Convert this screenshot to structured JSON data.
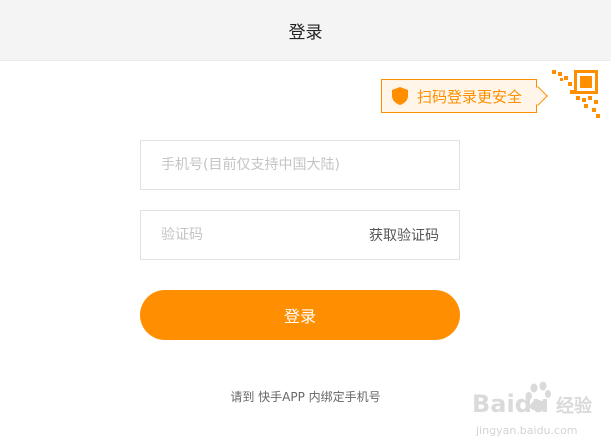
{
  "header": {
    "title": "登录"
  },
  "qr_login": {
    "tip_text": "扫码登录更安全",
    "icon": "shield-icon",
    "corner_icon": "qr-code-icon"
  },
  "form": {
    "phone": {
      "value": "",
      "placeholder": "手机号(目前仅支持中国大陆)"
    },
    "code": {
      "value": "",
      "placeholder": "验证码",
      "get_code_label": "获取验证码"
    },
    "submit_label": "登录"
  },
  "footer": {
    "bind_tip": "请到 快手APP 内绑定手机号"
  },
  "watermark": {
    "brand": "Baidu",
    "suffix": "经验",
    "url": "jingyan.baidu.com"
  },
  "colors": {
    "accent": "#ff8f00",
    "header_bg": "#f4f4f4",
    "tip_bg": "#fff5e8"
  }
}
